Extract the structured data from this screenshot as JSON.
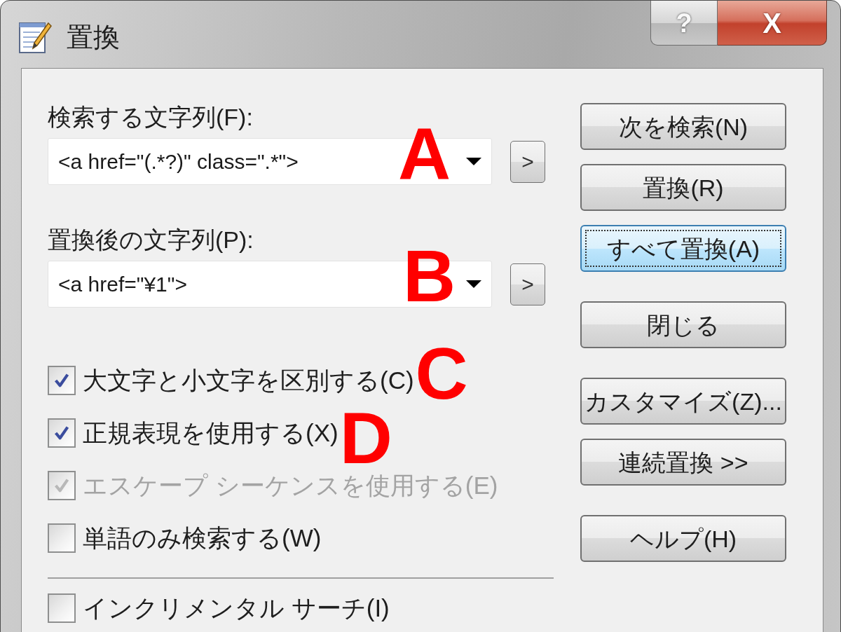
{
  "window": {
    "title": "置換",
    "help_button": "?",
    "close_button": "X"
  },
  "find": {
    "label": "検索する文字列(F):",
    "value": "<a href=\"(.*?)\" class=\".*\">",
    "history_button": ">",
    "annotation": "A"
  },
  "replace": {
    "label": "置換後の文字列(P):",
    "value": "<a href=\"¥1\">",
    "history_button": ">",
    "annotation": "B"
  },
  "options": [
    {
      "label": "大文字と小文字を区別する(C)",
      "checked": true,
      "disabled": false,
      "annotation": "C"
    },
    {
      "label": "正規表現を使用する(X)",
      "checked": true,
      "disabled": false,
      "annotation": "D"
    },
    {
      "label": "エスケープ シーケンスを使用する(E)",
      "checked": true,
      "disabled": true
    },
    {
      "label": "単語のみ検索する(W)",
      "checked": false,
      "disabled": false
    }
  ],
  "incremental_search": {
    "label": "インクリメンタル サーチ(I)",
    "checked": false
  },
  "button_groups": [
    [
      {
        "label": "次を検索(N)",
        "focused": false
      },
      {
        "label": "置換(R)",
        "focused": false
      },
      {
        "label": "すべて置換(A)",
        "focused": true
      }
    ],
    [
      {
        "label": "閉じる",
        "focused": false
      }
    ],
    [
      {
        "label": "カスタマイズ(Z)...",
        "focused": false
      },
      {
        "label": "連続置換 >>",
        "focused": false
      }
    ],
    [
      {
        "label": "ヘルプ(H)",
        "focused": false
      }
    ]
  ]
}
